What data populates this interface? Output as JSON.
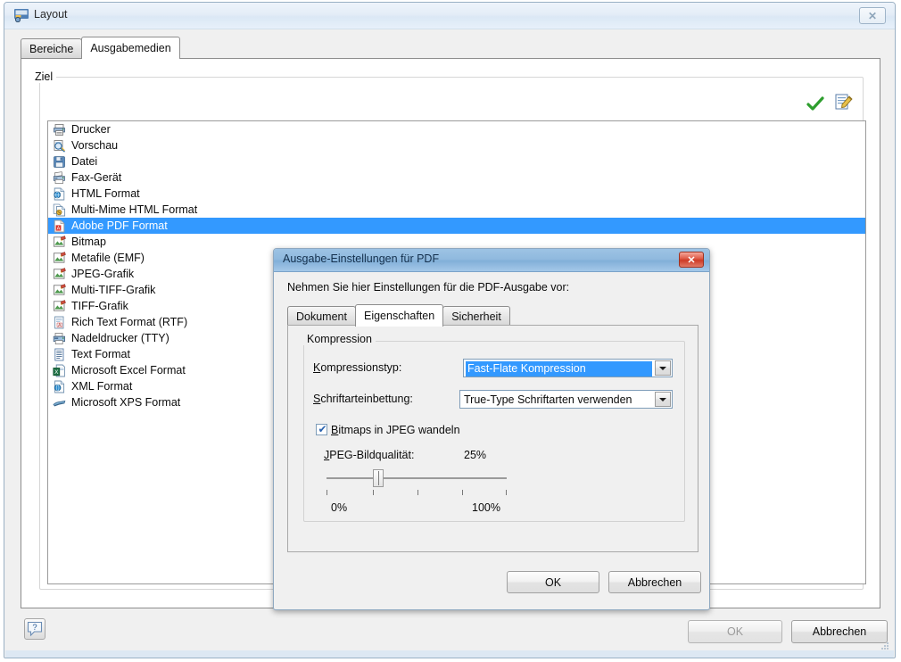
{
  "window": {
    "title": "Layout",
    "icon": "layout-window-icon",
    "close_label": "✕",
    "tabs": [
      {
        "label": "Bereiche",
        "active": false
      },
      {
        "label": "Ausgabemedien",
        "active": true
      }
    ],
    "group": {
      "legend": "Ziel",
      "toolbar": [
        {
          "name": "confirm-check-icon",
          "glyph": "✔"
        },
        {
          "name": "properties-icon",
          "glyph": "▤"
        }
      ]
    },
    "list": {
      "items": [
        {
          "label": "Drucker",
          "icon": "printer-icon",
          "selected": false
        },
        {
          "label": "Vorschau",
          "icon": "preview-magnifier-icon",
          "selected": false
        },
        {
          "label": "Datei",
          "icon": "file-save-icon",
          "selected": false
        },
        {
          "label": "Fax-Gerät",
          "icon": "fax-icon",
          "selected": false
        },
        {
          "label": "HTML Format",
          "icon": "html-document-icon",
          "selected": false
        },
        {
          "label": "Multi-Mime HTML Format",
          "icon": "multimime-html-icon",
          "selected": false
        },
        {
          "label": "Adobe PDF Format",
          "icon": "pdf-icon",
          "selected": true
        },
        {
          "label": "Bitmap",
          "icon": "bitmap-image-icon",
          "selected": false
        },
        {
          "label": "Metafile (EMF)",
          "icon": "metafile-image-icon",
          "selected": false
        },
        {
          "label": "JPEG-Grafik",
          "icon": "jpeg-image-icon",
          "selected": false
        },
        {
          "label": "Multi-TIFF-Grafik",
          "icon": "multitiff-image-icon",
          "selected": false
        },
        {
          "label": "TIFF-Grafik",
          "icon": "tiff-image-icon",
          "selected": false
        },
        {
          "label": "Rich Text Format (RTF)",
          "icon": "rtf-document-icon",
          "selected": false
        },
        {
          "label": "Nadeldrucker (TTY)",
          "icon": "dotmatrix-printer-icon",
          "selected": false
        },
        {
          "label": "Text Format",
          "icon": "text-document-icon",
          "selected": false
        },
        {
          "label": "Microsoft Excel Format",
          "icon": "excel-document-icon",
          "selected": false
        },
        {
          "label": "XML Format",
          "icon": "xml-document-icon",
          "selected": false
        },
        {
          "label": "Microsoft XPS Format",
          "icon": "xps-document-icon",
          "selected": false
        }
      ]
    },
    "footer": {
      "help_label": "?",
      "ok_label": "OK",
      "cancel_label": "Abbrechen"
    }
  },
  "dialog": {
    "title": "Ausgabe-Einstellungen für PDF",
    "close_label": "✕",
    "prompt": "Nehmen Sie hier Einstellungen für die PDF-Ausgabe vor:",
    "tabs": [
      {
        "label": "Dokument",
        "active": false
      },
      {
        "label": "Eigenschaften",
        "active": true
      },
      {
        "label": "Sicherheit",
        "active": false
      }
    ],
    "group": {
      "legend": "Kompression",
      "compression_type": {
        "label_prefix": "K",
        "label_rest": "ompressionstyp:",
        "value": "Fast-Flate Kompression"
      },
      "font_embedding": {
        "label_prefix": "S",
        "label_rest": "chriftarteinbettung:",
        "value": "True-Type Schriftarten verwenden"
      },
      "bitmaps_checkbox": {
        "label_prefix": "B",
        "label_rest": "itmaps in JPEG wandeln",
        "checked": true,
        "mark": "✔"
      },
      "jpeg_quality": {
        "label_prefix": "J",
        "label_rest": "PEG-Bildqualität:",
        "value_label": "25%",
        "value": 25,
        "min_label": "0%",
        "max_label": "100%",
        "min": 0,
        "max": 100
      }
    },
    "buttons": {
      "ok_label": "OK",
      "cancel_label": "Abbrechen"
    }
  },
  "colors": {
    "selection_blue": "#3399ff",
    "dialog_title_blue": "#8fb9de",
    "close_red": "#cd3b26",
    "check_green": "#2e9e2e"
  }
}
